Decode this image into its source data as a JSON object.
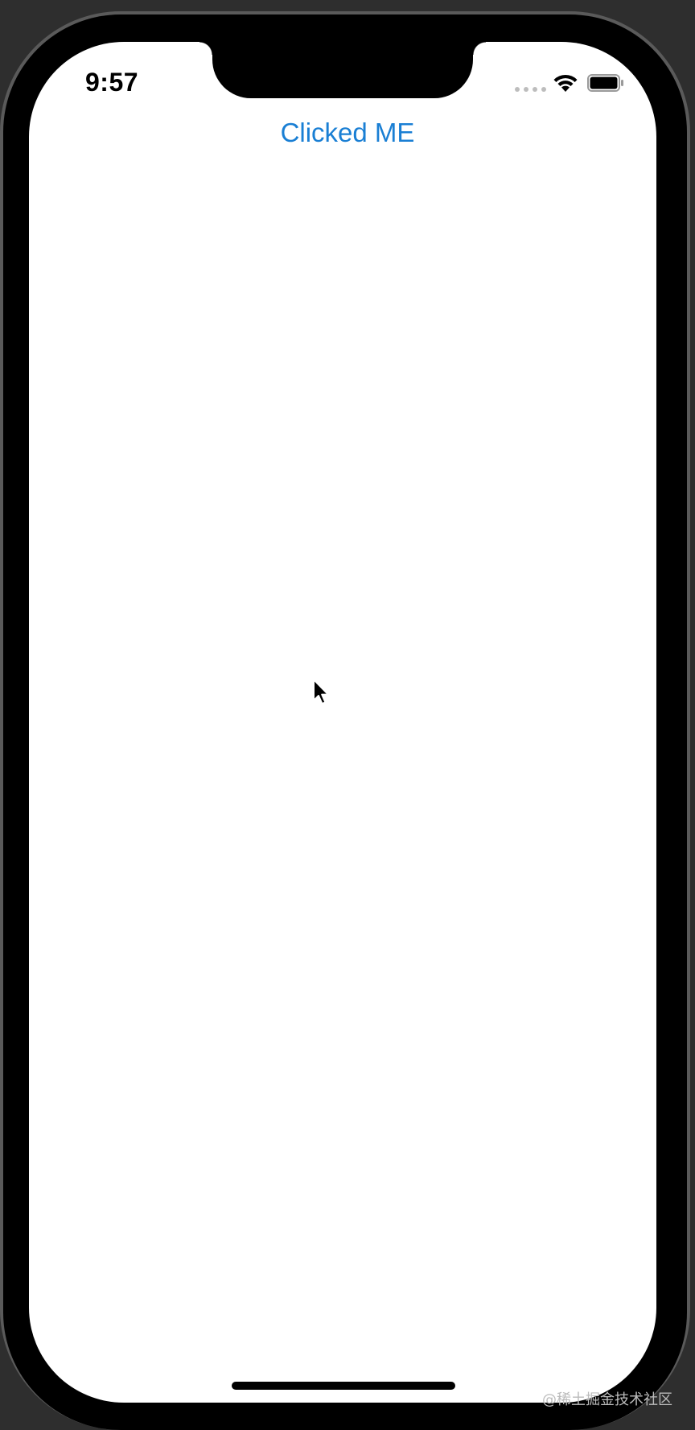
{
  "status_bar": {
    "time": "9:57",
    "signal_icon": "cellular-dots-icon",
    "wifi_icon": "wifi-icon",
    "battery_icon": "battery-full-icon"
  },
  "main": {
    "button_label": "Clicked ME",
    "button_color": "#1a7fd4"
  },
  "cursor": {
    "icon": "mouse-pointer-icon"
  },
  "watermark": {
    "text": "@稀土掘金技术社区"
  }
}
